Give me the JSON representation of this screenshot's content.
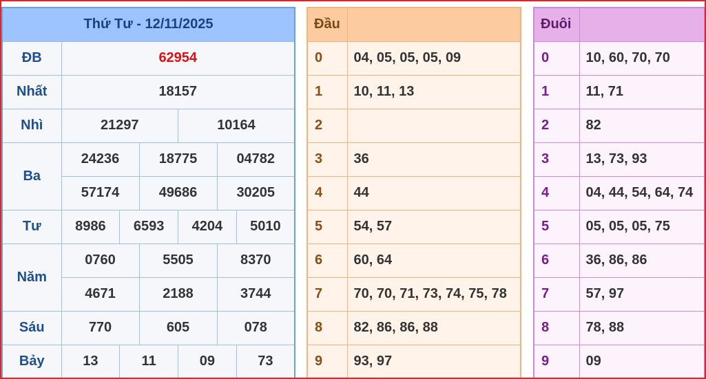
{
  "results": {
    "title": "Thứ Tư - 12/11/2025",
    "prizes": {
      "db": {
        "label": "ĐB",
        "numbers": [
          "62954"
        ]
      },
      "nhat": {
        "label": "Nhất",
        "numbers": [
          "18157"
        ]
      },
      "nhi": {
        "label": "Nhì",
        "numbers": [
          "21297",
          "10164"
        ]
      },
      "ba": {
        "label": "Ba",
        "numbers": [
          "24236",
          "18775",
          "04782",
          "57174",
          "49686",
          "30205"
        ]
      },
      "tu": {
        "label": "Tư",
        "numbers": [
          "8986",
          "6593",
          "4204",
          "5010"
        ]
      },
      "nam": {
        "label": "Năm",
        "numbers": [
          "0760",
          "5505",
          "8370",
          "4671",
          "2188",
          "3744"
        ]
      },
      "sau": {
        "label": "Sáu",
        "numbers": [
          "770",
          "605",
          "078"
        ]
      },
      "bay": {
        "label": "Bảy",
        "numbers": [
          "13",
          "11",
          "09",
          "73"
        ]
      }
    },
    "colors": {
      "special": "#e01010",
      "header": "#9ec4ff"
    }
  },
  "dau": {
    "header": "Đầu",
    "rows": [
      {
        "digit": "0",
        "values": "04, 05, 05, 05, 09"
      },
      {
        "digit": "1",
        "values": "10, 11, 13"
      },
      {
        "digit": "2",
        "values": ""
      },
      {
        "digit": "3",
        "values": "36"
      },
      {
        "digit": "4",
        "values": "44"
      },
      {
        "digit": "5",
        "values": "54, 57"
      },
      {
        "digit": "6",
        "values": "60, 64"
      },
      {
        "digit": "7",
        "values": "70, 70, 71, 73, 74, 75, 78"
      },
      {
        "digit": "8",
        "values": "82, 86, 86, 88"
      },
      {
        "digit": "9",
        "values": "93, 97"
      }
    ]
  },
  "duoi": {
    "header": "Đuôi",
    "rows": [
      {
        "digit": "0",
        "values": "10, 60, 70, 70"
      },
      {
        "digit": "1",
        "values": "11, 71"
      },
      {
        "digit": "2",
        "values": "82"
      },
      {
        "digit": "3",
        "values": "13, 73, 93"
      },
      {
        "digit": "4",
        "values": "04, 44, 54, 64, 74"
      },
      {
        "digit": "5",
        "values": "05, 05, 05, 75"
      },
      {
        "digit": "6",
        "values": "36, 86, 86"
      },
      {
        "digit": "7",
        "values": "57, 97"
      },
      {
        "digit": "8",
        "values": "78, 88"
      },
      {
        "digit": "9",
        "values": "09"
      }
    ]
  }
}
